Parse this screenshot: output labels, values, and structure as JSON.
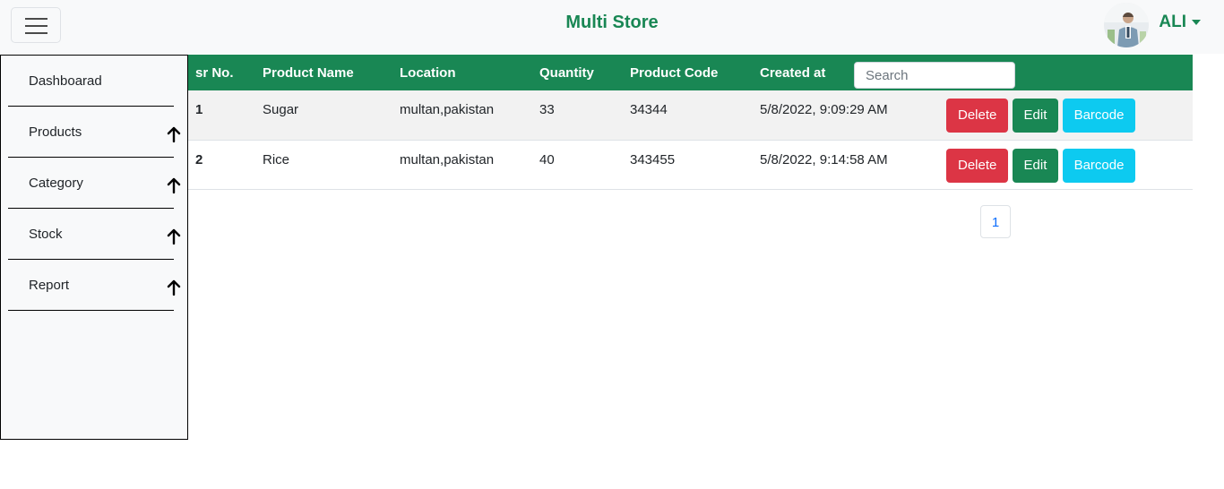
{
  "navbar": {
    "brand": "Multi Store",
    "user_name": "ALI",
    "avatar_icon": "user-avatar"
  },
  "sidebar": {
    "items": [
      {
        "label": "Dashboarad",
        "icon": ""
      },
      {
        "label": "Products",
        "icon": "arrow-up-icon"
      },
      {
        "label": "Category",
        "icon": "arrow-up-icon"
      },
      {
        "label": "Stock",
        "icon": "arrow-up-icon"
      },
      {
        "label": "Report",
        "icon": "arrow-up-icon"
      }
    ]
  },
  "table": {
    "headers": [
      "sr No.",
      "Product Name",
      "Location",
      "Quantity",
      "Product Code",
      "Created at"
    ],
    "search_placeholder": "Search",
    "rows": [
      {
        "sr": "1",
        "name": "Sugar",
        "location": "multan,pakistan",
        "quantity": "33",
        "code": "34344",
        "created": "5/8/2022, 9:09:29 AM"
      },
      {
        "sr": "2",
        "name": "Rice",
        "location": "multan,pakistan",
        "quantity": "40",
        "code": "343455",
        "created": "5/8/2022, 9:14:58 AM"
      }
    ],
    "actions": {
      "delete": "Delete",
      "edit": "Edit",
      "barcode": "Barcode"
    }
  },
  "pagination": {
    "current_page": "1"
  },
  "colors": {
    "primary": "#198754",
    "danger": "#dc3545",
    "info": "#0dcaf0",
    "link": "#0d6efd"
  }
}
